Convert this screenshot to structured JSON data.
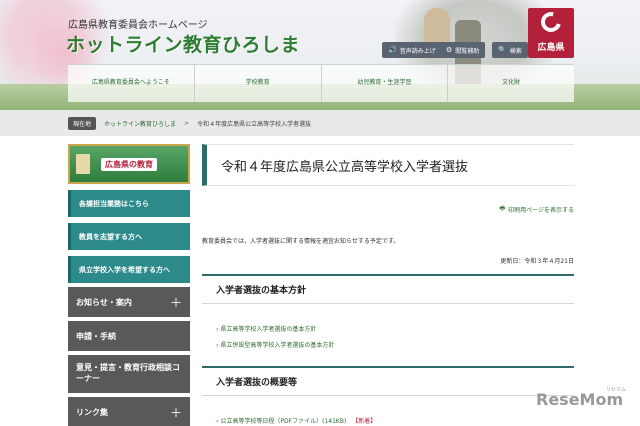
{
  "header": {
    "subtitle": "広島県教育委員会ホームページ",
    "title": "ホットライン教育ひろしま",
    "utility": [
      {
        "label": "音声読み上げ",
        "icon": "speaker-icon"
      },
      {
        "label": "閲覧補助",
        "icon": "gear-icon"
      },
      {
        "label": "検索",
        "icon": "search-icon"
      }
    ],
    "pref_logo": "広島県",
    "nav": [
      {
        "label": "広島県教育委員会へようこそ"
      },
      {
        "label": "学校教育"
      },
      {
        "label": "幼児教育・生涯学習"
      },
      {
        "label": "文化財"
      }
    ]
  },
  "breadcrumb": {
    "badge": "現在地",
    "items": [
      "ホットライン教育ひろしま",
      "令和４年度広島県公立高等学校入学者選抜"
    ],
    "separator": ">"
  },
  "sidebar": {
    "banner": "広島県の教育",
    "green_items": [
      "各課担当業務はこちら",
      "教員を志望する方へ",
      "県立学校入学を希望する方へ"
    ],
    "gray_items": [
      {
        "label": "お知らせ・案内",
        "expand": "＋"
      },
      {
        "label": "申請・手続",
        "expand": ""
      },
      {
        "label": "意見・提言・教育行政相談コーナー",
        "expand": ""
      },
      {
        "label": "リンク集",
        "expand": "＋"
      }
    ]
  },
  "main": {
    "title": "令和４年度広島県公立高等学校入学者選抜",
    "print_label": "印刷用ページを表示する",
    "intro": "教育委員会では，入学者選抜に関する情報を適宜お知らせする予定です。",
    "updated": "更新日：令和３年４月21日",
    "section1": {
      "title": "入学者選抜の基本方針",
      "links": [
        "県立高等学校入学者選抜の基本方針",
        "県立併設型高等学校入学者選抜の基本方針"
      ]
    },
    "section2": {
      "title": "入学者選抜の概要等",
      "links": [
        {
          "label": "公立高等学校等日程（PDFファイル）(141KB)",
          "badge": "【新着】"
        }
      ]
    }
  },
  "watermark": {
    "text": "ReseMom",
    "small": "リセマム"
  },
  "colors": {
    "brand_green": "#2f7d32",
    "teal": "#2d8a8a",
    "pref_red": "#b3203a",
    "sidebar_gray": "#595959"
  }
}
